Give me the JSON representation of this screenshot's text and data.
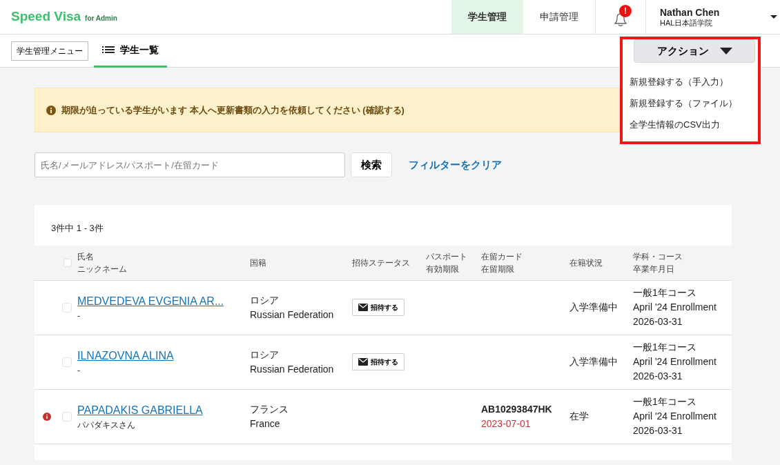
{
  "brand": {
    "name": "Speed Visa",
    "suffix": "for Admin"
  },
  "nav": [
    {
      "label": "学生管理",
      "selected": true
    },
    {
      "label": "申請管理",
      "selected": false
    }
  ],
  "notifications": {
    "badge": "!"
  },
  "user": {
    "name": "Nathan Chen",
    "school": "HAL日本語学院"
  },
  "subnav": {
    "menu_button": "学生管理メニュー",
    "tabs": [
      {
        "label": "学生一覧",
        "selected": true
      }
    ]
  },
  "actions": {
    "label": "アクション",
    "expanded": true,
    "items": [
      "新規登録する（手入力）",
      "新規登録する（ファイル）",
      "全学生情報のCSV出力"
    ]
  },
  "alert": {
    "text": "期限が迫っている学生がいます 本人へ更新書類の入力を依頼してください (確認する)"
  },
  "search": {
    "placeholder": "氏名/メールアドレス/パスポート/在留カード",
    "button": "検索",
    "clear_link": "フィルターをクリア"
  },
  "table": {
    "count": "3件中  1 - 3件",
    "all_checked": false,
    "columns": [
      [
        "氏名",
        "ニックネーム"
      ],
      [
        "国籍"
      ],
      [
        "招待ステータス"
      ],
      [
        "パスポート",
        "有効期限"
      ],
      [
        "在留カード",
        "在留期限"
      ],
      [
        "在籍状況"
      ],
      [
        "学科・コース",
        "卒業年月日"
      ]
    ],
    "rows": [
      {
        "warning": false,
        "checked": false,
        "name": "MEDVEDEVA EVGENIA AR...",
        "nickname": "-",
        "nationality_ja": "ロシア",
        "nationality_en": "Russian Federation",
        "invite": "招待する",
        "status": "入学準備中",
        "course": "一般1年コース",
        "term": "April '24 Enrollment",
        "graduation": "2026-03-31"
      },
      {
        "warning": false,
        "checked": false,
        "name": "ILNAZOVNA ALINA",
        "nickname": "-",
        "nationality_ja": "ロシア",
        "nationality_en": "Russian Federation",
        "invite": "招待する",
        "status": "入学準備中",
        "course": "一般1年コース",
        "term": "April '24 Enrollment",
        "graduation": "2026-03-31"
      },
      {
        "warning": true,
        "checked": false,
        "name": "PAPADAKIS GABRIELLA",
        "nickname": "パパダキスさん",
        "nationality_ja": "フランス",
        "nationality_en": "France",
        "card_no": "AB10293847HK",
        "card_expiry": "2023-07-01",
        "expired": true,
        "status": "在学",
        "course": "一般1年コース",
        "term": "April '24 Enrollment",
        "graduation": "2026-03-31"
      }
    ]
  }
}
